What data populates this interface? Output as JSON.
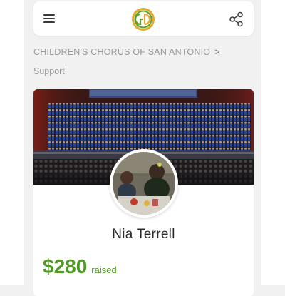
{
  "header": {
    "menu_icon": "hamburger-menu-icon",
    "logo_icon": "organization-logo-icon",
    "share_icon": "share-icon"
  },
  "breadcrumb": {
    "parent": "CHILDREN'S CHORUS OF SAN ANTONIO",
    "separator": ">",
    "current": "Support!"
  },
  "profile": {
    "name": "Nia Terrell",
    "amount": "$280",
    "raised_label": "raised"
  },
  "colors": {
    "accent_green": "#4f9a23",
    "logo_gold": "#e3a92c",
    "logo_green": "#5aa42e"
  }
}
